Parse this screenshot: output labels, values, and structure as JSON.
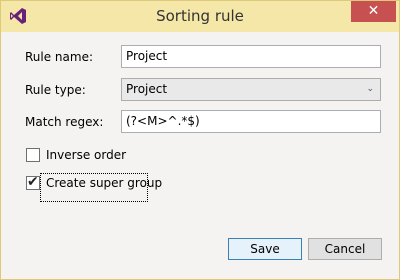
{
  "window": {
    "title": "Sorting rule",
    "close_label": "✕",
    "app_icon": "visual-studio-logo-icon"
  },
  "form": {
    "rule_name_label": "Rule name:",
    "rule_name_value": "Project",
    "rule_type_label": "Rule type:",
    "rule_type_value": "Project",
    "match_regex_label": "Match regex:",
    "match_regex_value": "(?<M>^.*$)",
    "inverse_order_label": "Inverse order",
    "inverse_order_checked": false,
    "create_super_group_label": "Create super group",
    "create_super_group_checked": true
  },
  "buttons": {
    "save_label": "Save",
    "cancel_label": "Cancel"
  },
  "colors": {
    "titlebar": "#f4e7a7",
    "close": "#c75050",
    "icon": "#68217a"
  }
}
